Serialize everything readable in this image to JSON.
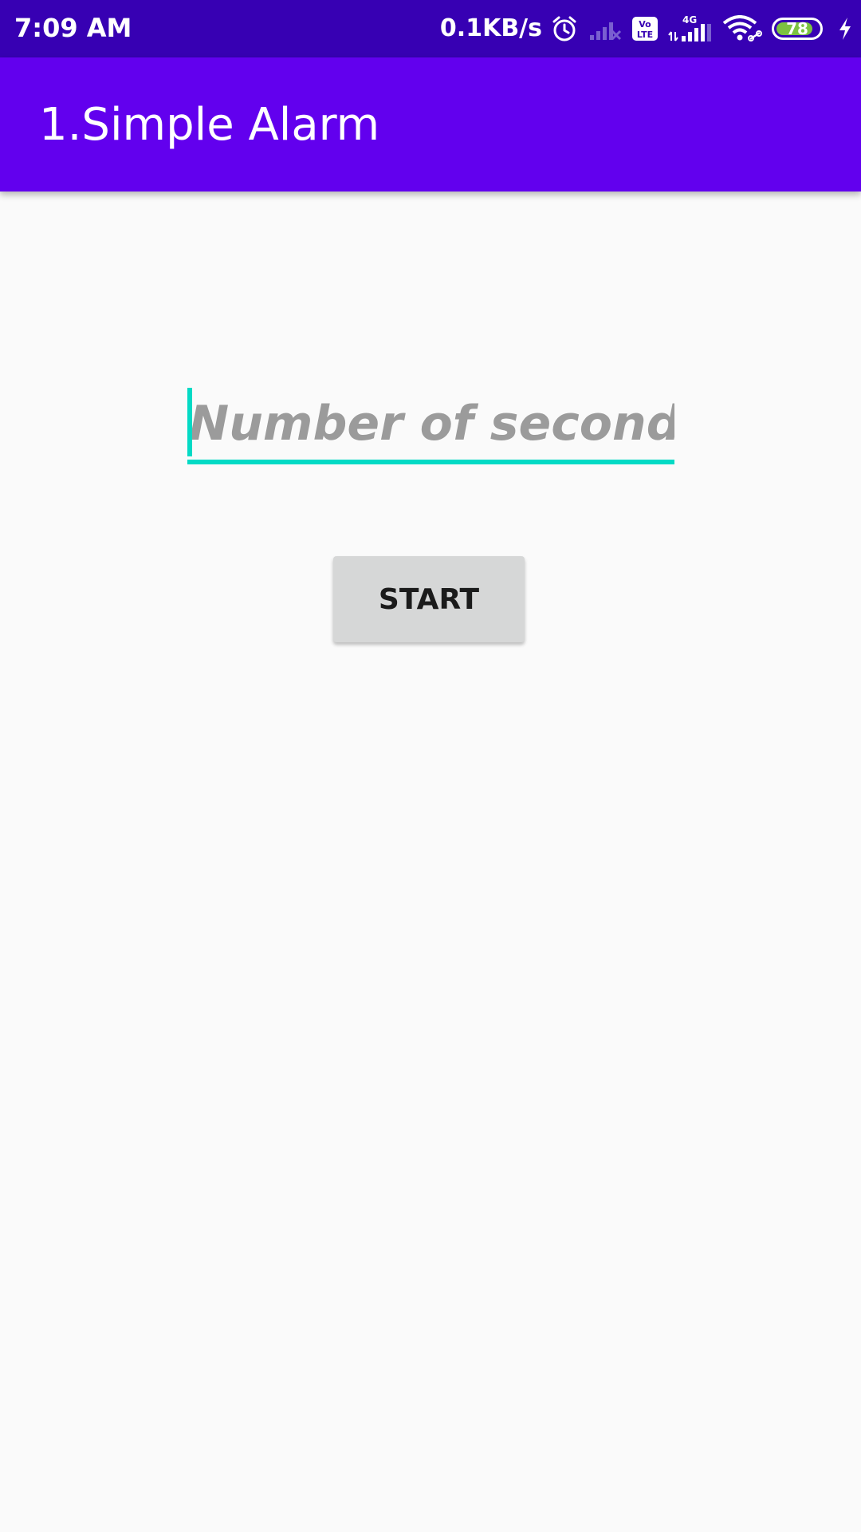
{
  "status_bar": {
    "time": "7:09 AM",
    "net_speed": "0.1KB/s",
    "battery_level": "78",
    "icons": [
      "alarm-icon",
      "signal-off-icon",
      "volte-icon",
      "4g-signal-icon",
      "wifi-icon",
      "battery-icon",
      "charging-icon"
    ],
    "volte_label": "Vo LTE",
    "network_label": "4G"
  },
  "app_bar": {
    "title": "1.Simple Alarm"
  },
  "main": {
    "seconds_input": {
      "value": "",
      "placeholder": "Number of seconds..."
    },
    "start_button_label": "START"
  },
  "colors": {
    "status_bar": "#3700B3",
    "app_bar": "#6200EE",
    "accent": "#03DAC5",
    "background": "#FAFAFA",
    "button": "#D6D7D7"
  }
}
